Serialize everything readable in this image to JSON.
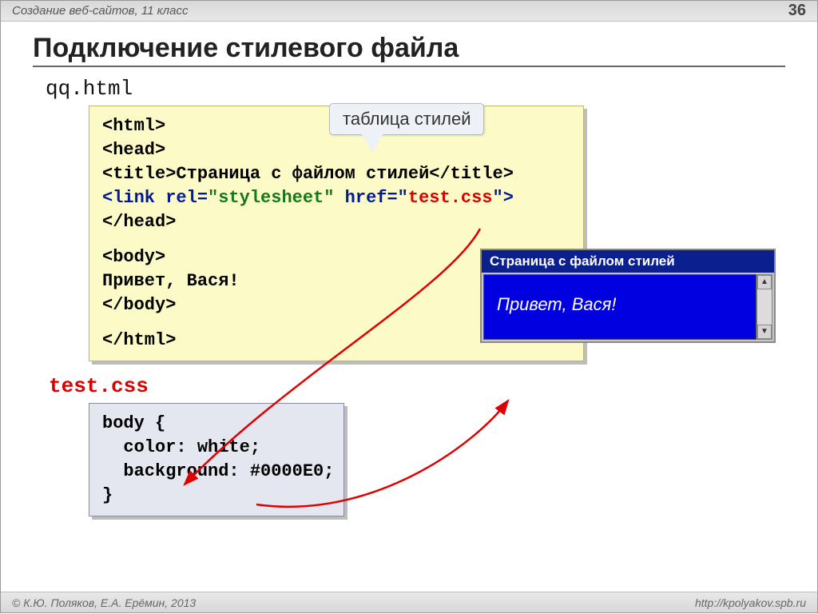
{
  "header": {
    "breadcrumb": "Создание веб-сайтов, 11 класс",
    "page": "36"
  },
  "title": "Подключение стилевого файла",
  "html_file_label": "qq.html",
  "callout": "таблица стилей",
  "html_code": {
    "tag_html_open": "<html>",
    "tag_head_open": "<head>",
    "title_open": "<title>",
    "title_text": "Страница с файлом стилей",
    "title_close": "</title>",
    "link_open": "<link rel=",
    "attr_rel": "\"stylesheet\"",
    "link_href": " href=\"",
    "css_ref": "test.css",
    "link_close": "\">",
    "tag_head_close": "</head>",
    "tag_body_open": "<body>",
    "body_text": "Привет, Вася!",
    "tag_body_close": "</body>",
    "tag_html_close": "</html>"
  },
  "css_file_label": "test.css",
  "css_code": {
    "l1": "body {",
    "l2": "  color: white;",
    "l3": "  background: #0000E0;",
    "l4": "}"
  },
  "browser": {
    "title": "Страница с файлом стилей",
    "body": "Привет, Вася!"
  },
  "footer": {
    "copyright": "© К.Ю. Поляков, Е.А. Ерёмин, 2013",
    "link": "http://kpolyakov.spb.ru"
  }
}
